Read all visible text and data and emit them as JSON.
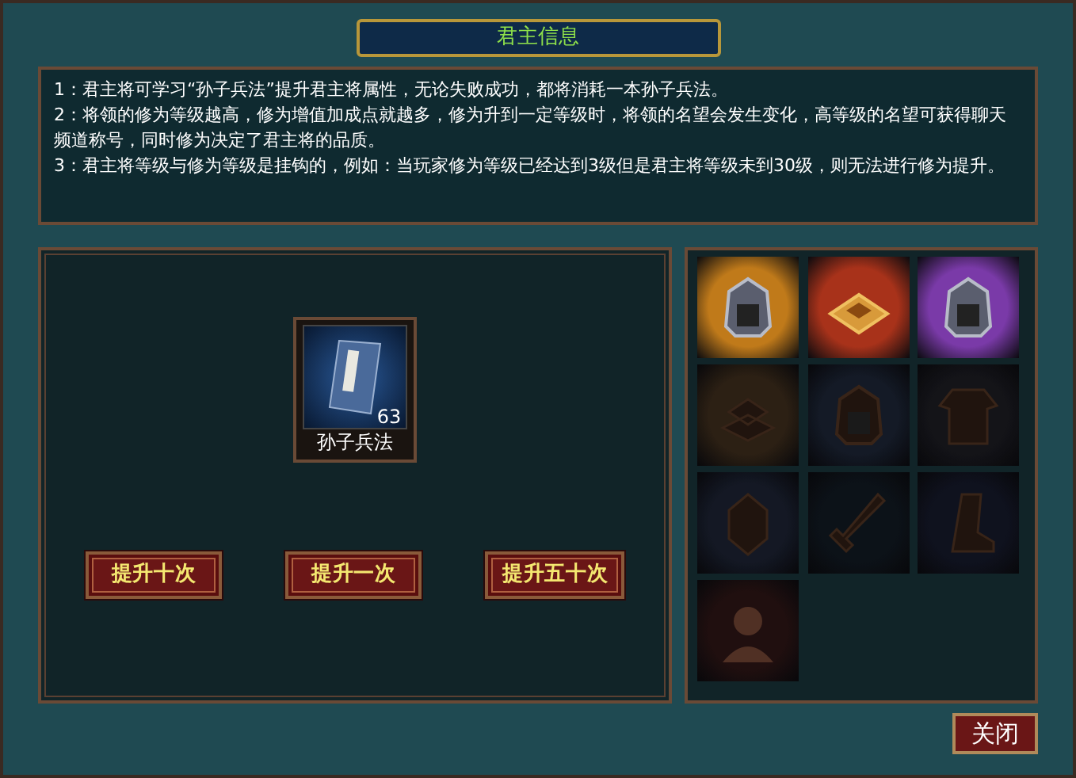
{
  "window": {
    "title": "君主信息"
  },
  "info_lines": [
    "1：君主将可学习“孙子兵法”提升君主将属性，无论失败成功，都将消耗一本孙子兵法。",
    "2：将领的修为等级越高，修为增值加成点就越多，修为升到一定等级时，将领的名望会发生变化，高等级的名望可获得聊天频道称号，同时修为决定了君主将的品质。",
    "3：君主将等级与修为等级是挂钩的，例如：当玩家修为等级已经达到3级但是君主将等级未到30级，则无法进行修为提升。"
  ],
  "item": {
    "name": "孙子兵法",
    "count": "63"
  },
  "buttons": [
    "提升十次",
    "提升一次",
    "提升五十次"
  ],
  "equipment": [
    {
      "kind": "helmet",
      "lit": true,
      "color": "#c07a1a"
    },
    {
      "kind": "fortress",
      "lit": true,
      "color": "#a8321a"
    },
    {
      "kind": "helmet",
      "lit": true,
      "color": "#7a3aa8"
    },
    {
      "kind": "pagoda",
      "lit": false,
      "color": "#3a2a1a"
    },
    {
      "kind": "helmet",
      "lit": false,
      "color": "#1a2232"
    },
    {
      "kind": "armor",
      "lit": false,
      "color": "#1a1a20"
    },
    {
      "kind": "mask",
      "lit": false,
      "color": "#1a2030"
    },
    {
      "kind": "weapon",
      "lit": false,
      "color": "#101820"
    },
    {
      "kind": "boot",
      "lit": false,
      "color": "#141828"
    },
    {
      "kind": "portrait",
      "lit": false,
      "color": "#2a1414"
    }
  ],
  "close_button": "关闭"
}
